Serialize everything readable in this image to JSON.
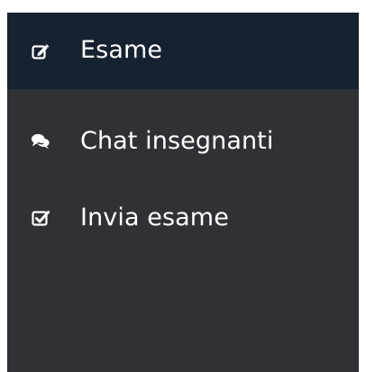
{
  "menu": {
    "items": [
      {
        "label": "Esame",
        "icon": "edit-icon",
        "active": true
      },
      {
        "label": "Chat insegnanti",
        "icon": "comments-icon",
        "active": false
      },
      {
        "label": "Invia esame",
        "icon": "check-square-icon",
        "active": false
      }
    ]
  },
  "colors": {
    "active_background": "#162230",
    "menu_background": "#2f3134",
    "text": "#ffffff"
  }
}
